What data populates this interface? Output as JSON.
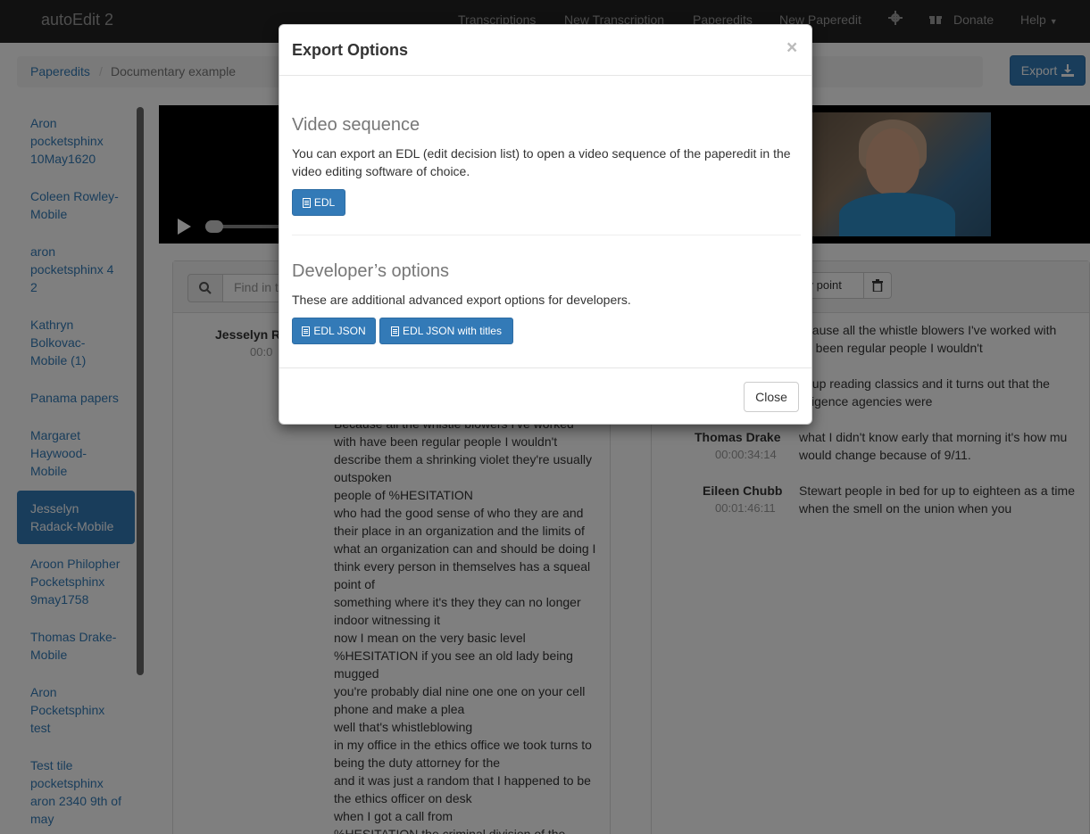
{
  "app": {
    "brand": "autoEdit 2",
    "nav": [
      "Transcriptions",
      "New Transcription",
      "Paperedits",
      "New Paperedit"
    ],
    "donate": "Donate",
    "help": "Help"
  },
  "breadcrumb": {
    "root": "Paperedits",
    "separator": "/",
    "current": "Documentary example"
  },
  "export_button": "Export",
  "sidebar": {
    "items": [
      "Aron pocketsphinx 10May1620",
      "Coleen Rowley-Mobile",
      "aron pocketsphinx 4 2",
      "Kathryn Bolkovac-Mobile (1)",
      "Panama papers",
      "Margaret Haywood-Mobile",
      "Jesselyn Radack-Mobile",
      "Aroon Philopher Pocketsphinx 9may1758",
      "Thomas Drake-Mobile",
      "Aron Pocketsphinx test",
      "Test tile pocketsphinx aron 2340 9th of may"
    ],
    "active_index": 6
  },
  "left_panel": {
    "search_placeholder": "Find in t",
    "speaker": "Jesselyn R",
    "speaker_time": "00:0",
    "lines": [
      "Because all the whistle blowers I've worked",
      "with have been regular people I wouldn't",
      "describe them a shrinking violet they're usually",
      "outspoken",
      "people of %HESITATION",
      "who had the good sense of who they are and",
      "their place in an organization and the limits of",
      "what an organization can and should be doing I",
      "think every person in themselves has a squeal",
      "point of",
      "something where it's they they can no longer",
      "indoor witnessing it",
      "now I mean on the very basic level",
      "%HESITATION if you see an old lady being",
      "mugged",
      "you're probably dial nine one one on your cell",
      "phone and make a plea",
      "well that's whistleblowing",
      "in my office in the ethics office we took turns to",
      "being the duty attorney for the",
      "and it was just a random that I happened to be",
      "the ethics officer on desk",
      "when I got a call from",
      "%HESITATION the criminal division of the"
    ]
  },
  "right_panel": {
    "story_point": "ory point",
    "entries": [
      {
        "speaker": "",
        "time": "",
        "lines": [
          "ecause all the whistle blowers I've worked with",
          "ve been regular people I wouldn't"
        ]
      },
      {
        "speaker": "",
        "time": "",
        "lines": [
          "ld up reading classics and it turns out that the",
          "elligence agencies were"
        ]
      },
      {
        "speaker": "Thomas Drake",
        "time": "00:00:34:14",
        "lines": [
          "what I didn't know early that morning it's how mu",
          "would change because of 9/11."
        ]
      },
      {
        "speaker": "Eileen Chubb",
        "time": "00:01:46:11",
        "lines": [
          "Stewart people in bed for up to eighteen as a time",
          "when the smell on the union when you"
        ]
      }
    ]
  },
  "modal": {
    "title": "Export Options",
    "close_x": "×",
    "video_title": "Video sequence",
    "video_text": "You can export an EDL (edit decision list) to open a video sequence of the paperedit in the video editing software of choice.",
    "edl_button": "EDL",
    "dev_title": "Developer’s options",
    "dev_text": "These are additional advanced export options for developers.",
    "edl_json_button": "EDL JSON",
    "edl_json_titles_button": "EDL JSON with titles",
    "close_button": "Close"
  },
  "colors": {
    "primary": "#337ab7",
    "navbar": "#222222"
  }
}
